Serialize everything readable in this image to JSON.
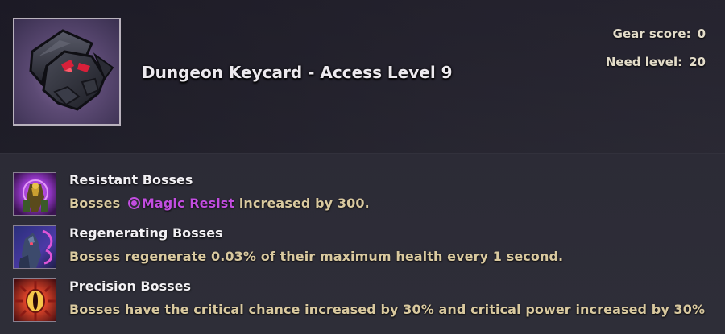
{
  "item": {
    "name": "Dungeon Keycard - Access Level 9",
    "icon": "keycard-icon"
  },
  "stats": {
    "gear_score_label": "Gear score:",
    "gear_score_value": "0",
    "need_level_label": "Need level:",
    "need_level_value": "20"
  },
  "modifiers": [
    {
      "title": "Resistant Bosses",
      "desc_prefix": "Bosses",
      "desc_highlight": "Magic Resist",
      "desc_suffix": "increased by 300.",
      "icon": "resistant-boss-icon",
      "highlight_color": "#c24de0"
    },
    {
      "title": "Regenerating Bosses",
      "desc": "Bosses regenerate 0.03% of their maximum health every 1 second.",
      "icon": "regenerating-boss-icon"
    },
    {
      "title": "Precision Bosses",
      "desc": "Bosses have the critical chance increased by 30% and critical power increased by 30%",
      "icon": "precision-boss-icon"
    }
  ]
}
